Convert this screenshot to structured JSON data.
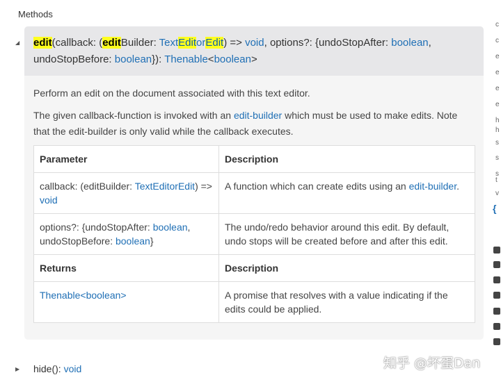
{
  "section": {
    "title": "Methods"
  },
  "edit_method": {
    "signature": {
      "name": "edit",
      "p1": "(callback: (",
      "editBuilder_hl": "edit",
      "editBuilder_rest": "Builder: ",
      "type_text": "Text",
      "type_edit_hl": "Edit",
      "type_or": "or",
      "type_edit2_hl": "Edit",
      "p2": ") => ",
      "void": "void",
      "p3": ", options?: {undoStopAfter: ",
      "boolean1": "boolean",
      "p4": ",",
      "p5": "undoStopBefore: ",
      "boolean2": "boolean",
      "p6": "}): ",
      "thenable": "Thenable",
      "lt": "<",
      "boolean3": "boolean",
      "gt": ">"
    },
    "description": "Perform an edit on the document associated with this text editor.",
    "callback_note": {
      "pre": "The given callback-function is invoked with an ",
      "link": "edit-builder",
      "post": " which must be used to make edits. Note that the edit-builder is only valid while the callback executes."
    },
    "table": {
      "headers": {
        "parameter": "Parameter",
        "description": "Description"
      },
      "rows": [
        {
          "param_pre": "callback: (editBuilder: ",
          "param_type": "TextEditorEdit",
          "param_mid": ") => ",
          "param_void": "void",
          "desc_pre": "A function which can create edits using an ",
          "desc_link": "edit-builder",
          "desc_post": "."
        },
        {
          "param_pre": "options?: {undoStopAfter: ",
          "param_b1": "boolean",
          "param_mid": ", undoStopBefore: ",
          "param_b2": "boolean",
          "param_post": "}",
          "desc": "The undo/redo behavior around this edit. By default, undo stops will be created before and after this edit."
        }
      ],
      "returns_headers": {
        "returns": "Returns",
        "description": "Description"
      },
      "returns_row": {
        "thenable": "Thenable",
        "lt": "<",
        "boolean": "boolean",
        "gt": ">",
        "desc": "A promise that resolves with a value indicating if the edits could be applied."
      }
    }
  },
  "hide_method": {
    "name": "hide(): ",
    "void": "void"
  },
  "right_strip": {
    "chars": [
      "c",
      "c",
      "e",
      "e",
      "e",
      "e",
      "h",
      "h",
      "s",
      "s",
      "s",
      "t",
      "v"
    ],
    "brace": "{",
    "icons": [
      "twitter-icon",
      "rss-icon",
      "stackoverflow-icon",
      "twitter-icon",
      "github-icon",
      "chat-icon",
      "youtube-icon"
    ]
  },
  "watermark": "知乎 @坏蛋Dan",
  "colors": {
    "link": "#1f6fb5",
    "highlight": "#ffff1e",
    "panel": "#f5f5f5",
    "signature_bg": "#e7e7e9"
  }
}
